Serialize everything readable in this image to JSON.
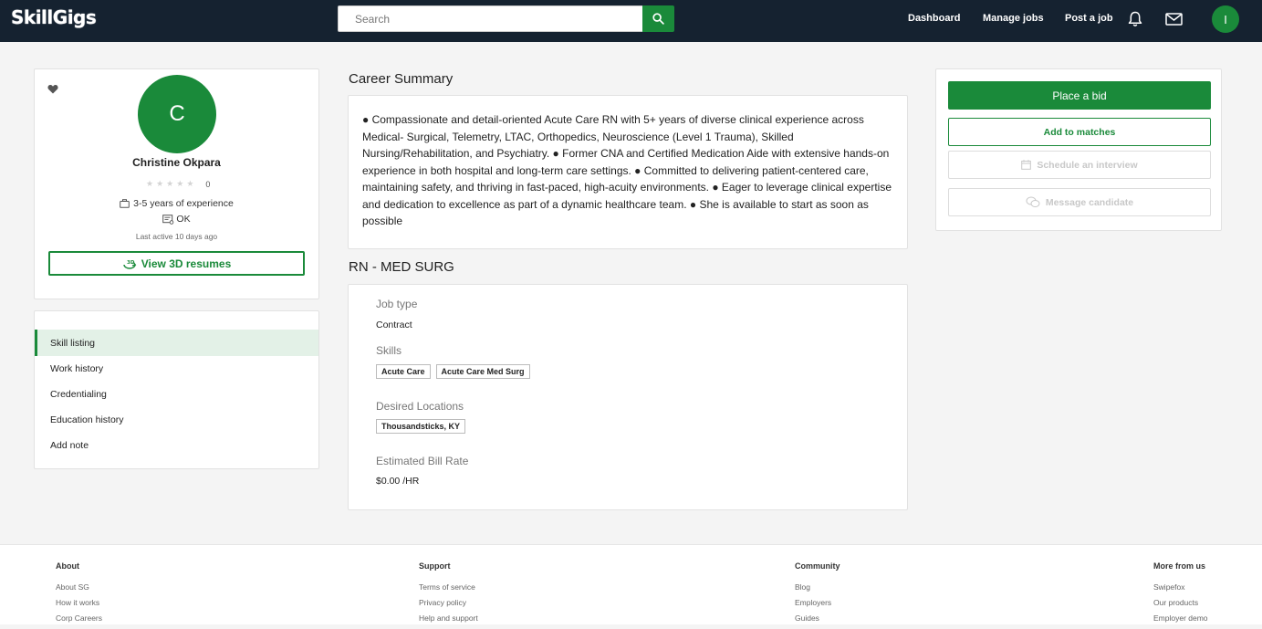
{
  "header": {
    "logo": "SkillGigs",
    "search_placeholder": "Search",
    "nav": [
      "Dashboard",
      "Manage jobs",
      "Post a job"
    ],
    "user_initial": "I"
  },
  "profile": {
    "initial": "C",
    "name": "Christine Okpara",
    "rating": 0,
    "rating_count": "0",
    "experience": "3-5 years of experience",
    "location": "OK",
    "last_active": "Last active 10 days ago",
    "view_resumes_label": "View 3D resumes"
  },
  "side_menu": {
    "items": [
      "Skill listing",
      "Work history",
      "Credentialing",
      "Education history",
      "Add note"
    ],
    "active_index": 0
  },
  "summary": {
    "title": "Career Summary",
    "text": "● Compassionate and detail-oriented Acute Care RN with 5+ years of diverse clinical experience across Medical- Surgical, Telemetry, LTAC, Orthopedics, Neuroscience (Level 1 Trauma), Skilled Nursing/Rehabilitation, and Psychiatry. ● Former CNA and Certified Medication Aide with extensive hands-on experience in both hospital and long-term care settings. ● Committed to delivering patient-centered care, maintaining safety, and thriving in fast-paced, high-acuity environments. ● Eager to leverage clinical expertise and dedication to excellence as part of a dynamic healthcare team. ● She is available to start as soon as possible"
  },
  "job": {
    "title": "RN - MED SURG",
    "job_type_label": "Job type",
    "job_type": "Contract",
    "skills_label": "Skills",
    "skills": [
      "Acute Care",
      "Acute Care Med Surg"
    ],
    "locations_label": "Desired Locations",
    "locations": [
      "Thousandsticks, KY"
    ],
    "bill_rate_label": "Estimated Bill Rate",
    "bill_rate": "$0.00 /HR"
  },
  "actions": {
    "place_bid": "Place a bid",
    "add_to_matches": "Add to matches",
    "schedule_interview": "Schedule an interview",
    "message_candidate": "Message candidate"
  },
  "footer": {
    "columns": [
      {
        "heading": "About",
        "links": [
          "About SG",
          "How it works",
          "Corp Careers"
        ]
      },
      {
        "heading": "Support",
        "links": [
          "Terms of service",
          "Privacy policy",
          "Help and support"
        ]
      },
      {
        "heading": "Community",
        "links": [
          "Blog",
          "Employers",
          "Guides"
        ]
      },
      {
        "heading": "More from us",
        "links": [
          "Swipefox",
          "Our products",
          "Employer demo"
        ]
      }
    ]
  },
  "colors": {
    "brand_green": "#1a8a3a",
    "header_bg": "#152230",
    "active_menu_bg": "#e3f1e7"
  }
}
